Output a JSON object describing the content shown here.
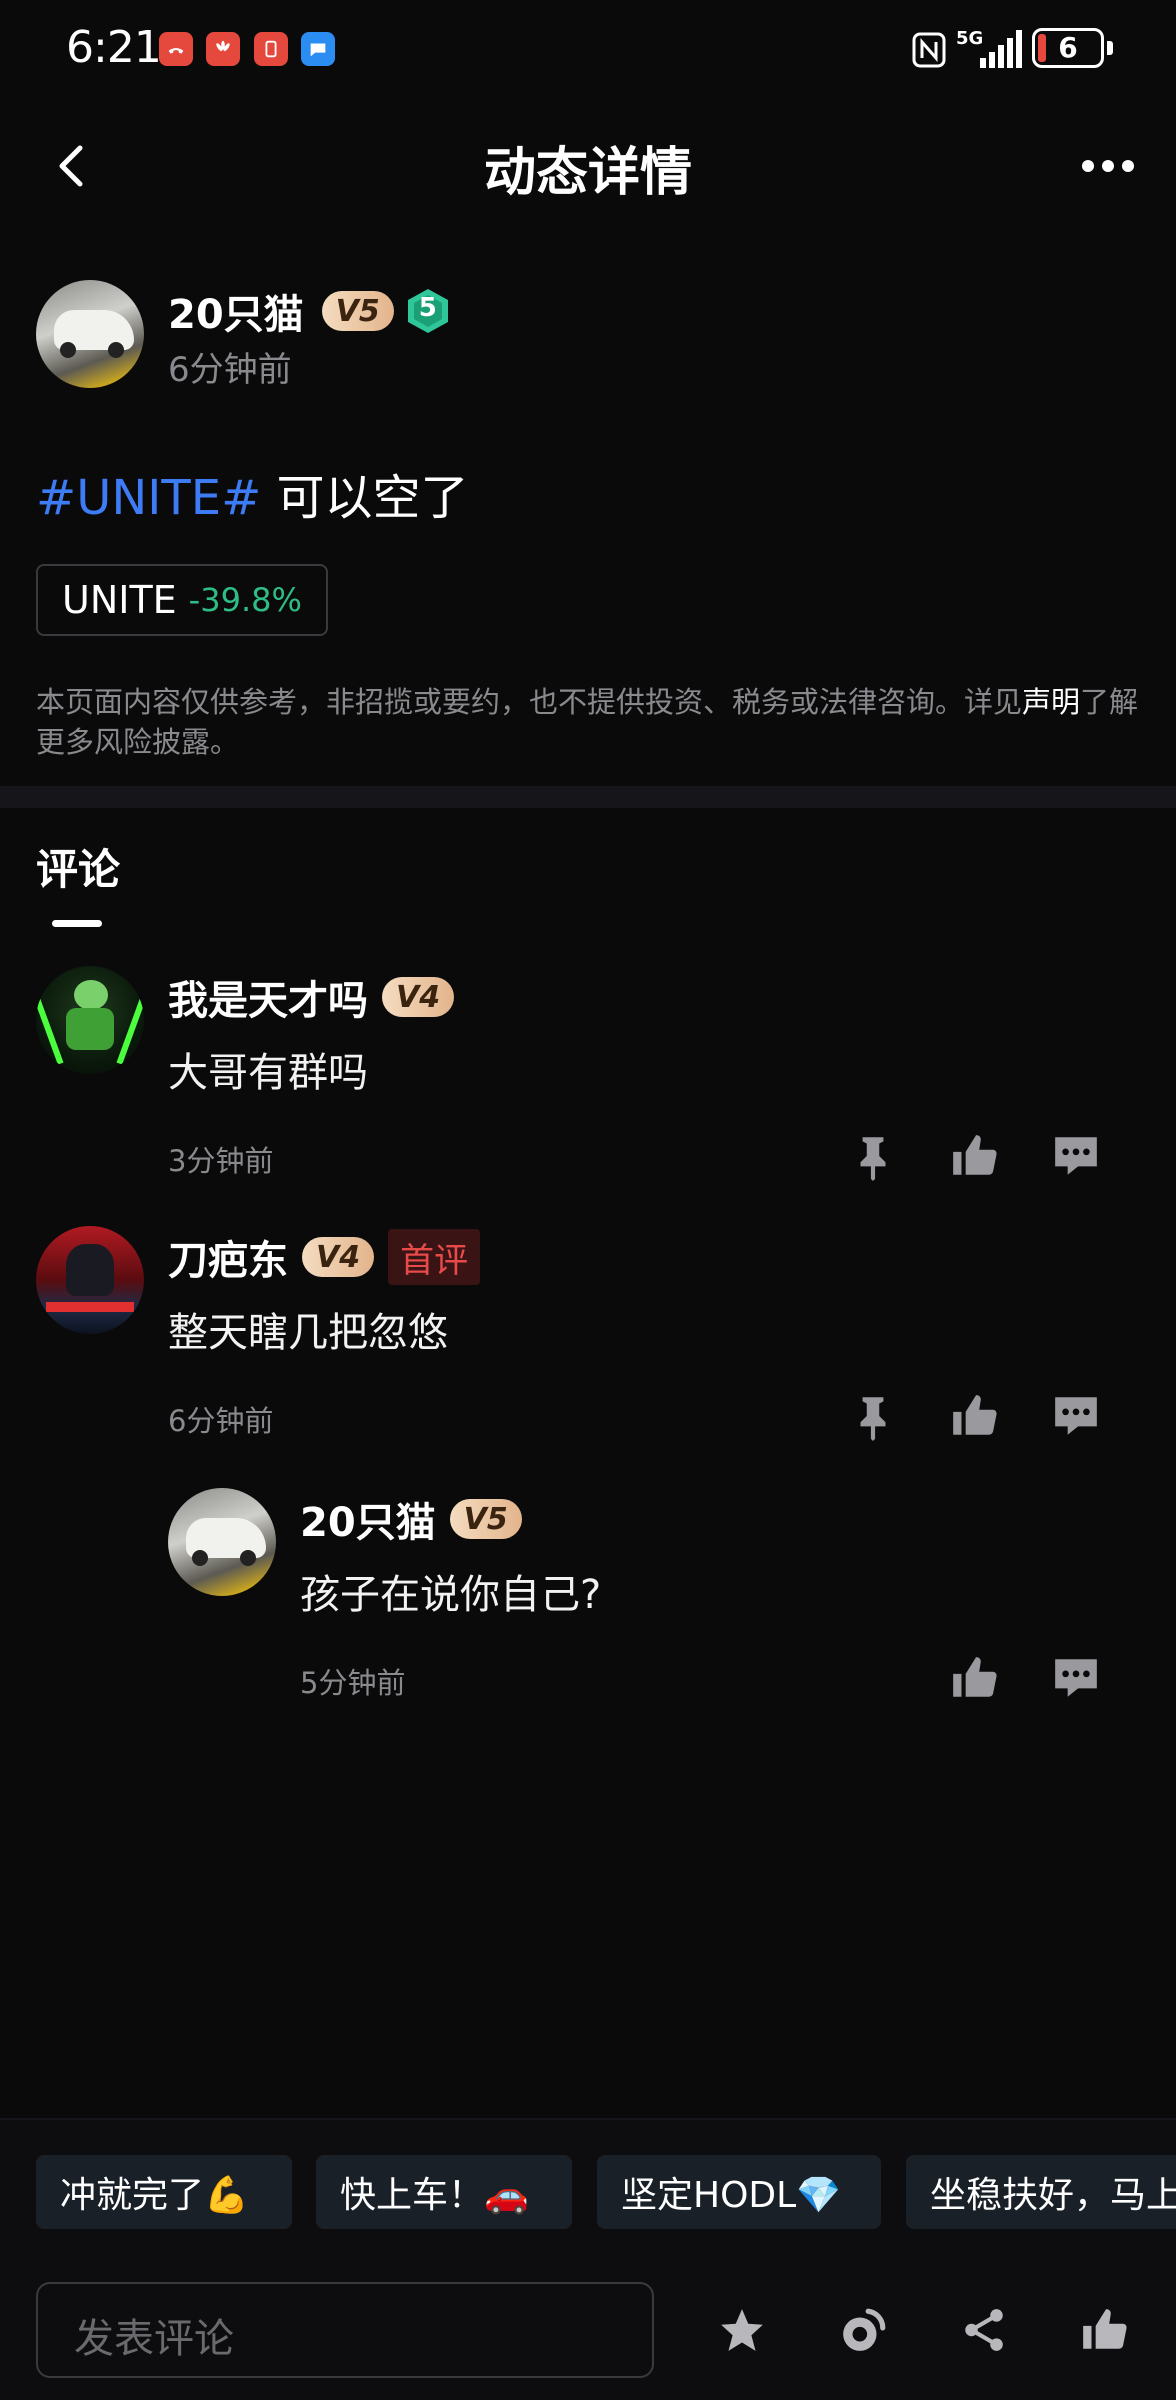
{
  "status_bar": {
    "time": "6:21",
    "network": "5G",
    "battery": "6"
  },
  "header": {
    "title": "动态详情"
  },
  "post": {
    "author": "20只猫",
    "vip_level": "V5",
    "rank_badge": "5",
    "time": "6分钟前",
    "hashtag": "#UNITE#",
    "text": " 可以空了",
    "ticker": {
      "symbol": "UNITE",
      "change": "-39.8%"
    },
    "disclaimer": "本页面内容仅供参考，非招揽或要约，也不提供投资、税务或法律咨询。详见",
    "disclaimer_link": "声明",
    "disclaimer_tail": "了解更多风险披露。"
  },
  "comments_section": {
    "tab_label": "评论",
    "comments": [
      {
        "author": "我是天才吗",
        "vip_level": "V4",
        "text": "大哥有群吗",
        "time": "3分钟前"
      },
      {
        "author": "刀疤东",
        "vip_level": "V4",
        "tag": "首评",
        "text": "整天瞎几把忽悠",
        "time": "6分钟前",
        "reply": {
          "author": "20只猫",
          "vip_level": "V5",
          "text": "孩子在说你自己?",
          "time": "5分钟前"
        }
      }
    ]
  },
  "quick_replies": [
    "冲就完了💪",
    "快上车！🚗",
    "坚定HODL💎",
    "坐稳扶好，马上"
  ],
  "bottom_bar": {
    "comment_placeholder": "发表评论"
  },
  "colors": {
    "background": "#0a0a0b",
    "hashtag": "#3d7cf5",
    "negative_change": "#2ebd85",
    "first_comment_tag": "#e84a4a",
    "vip_badge": "#e8bd94"
  }
}
